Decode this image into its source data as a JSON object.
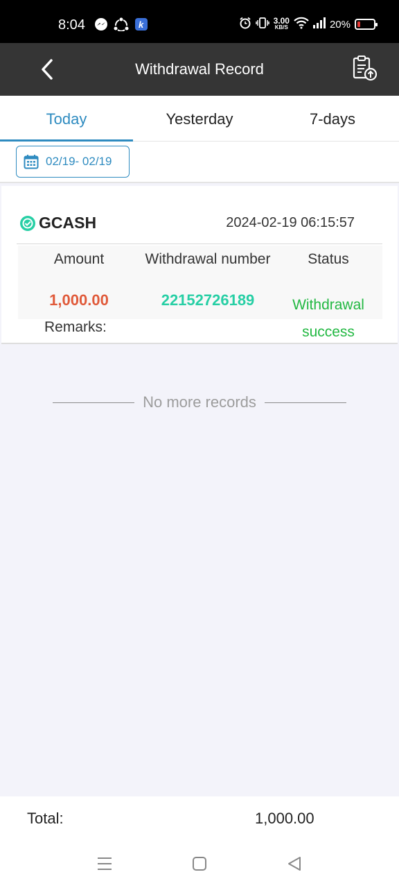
{
  "status_bar": {
    "time": "8:04",
    "net_speed_value": "3.00",
    "net_speed_unit": "KB/S",
    "battery_text": "20%",
    "battery_level": 0.2,
    "icons": [
      "messenger-icon",
      "sync-icon",
      "k-app-icon",
      "alarm-icon",
      "vibrate-icon",
      "wifi-icon",
      "signal-icon",
      "battery-icon"
    ]
  },
  "appbar": {
    "title": "Withdrawal Record",
    "back_icon": "chevron-left-icon",
    "export_icon": "clipboard-upload-icon"
  },
  "tabs": [
    {
      "label": "Today",
      "active": true
    },
    {
      "label": "Yesterday",
      "active": false
    },
    {
      "label": "7-days",
      "active": false
    }
  ],
  "date_filter": {
    "label": "02/19- 02/19",
    "icon": "calendar-icon"
  },
  "record": {
    "method": "GCASH",
    "datetime": "2024-02-19 06:15:57",
    "columns": {
      "amount": "Amount",
      "number": "Withdrawal number",
      "status": "Status"
    },
    "amount": "1,000.00",
    "withdrawal_number": "22152726189",
    "status_line1": "Withdrawal",
    "status_line2": "success",
    "remarks_label": "Remarks:"
  },
  "no_more": "No more records",
  "total": {
    "label": "Total:",
    "value": "1,000.00"
  },
  "colors": {
    "accent": "#2e8bc0",
    "amount": "#e05a3a",
    "number": "#27cfa5",
    "success": "#22b842",
    "appbar": "#353535"
  },
  "nav_icons": [
    "menu-icon",
    "home-icon",
    "back-triangle-icon"
  ]
}
